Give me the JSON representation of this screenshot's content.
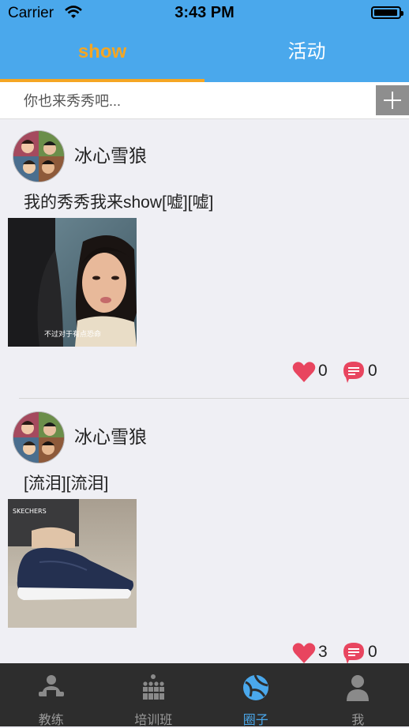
{
  "status_bar": {
    "carrier": "Carrier",
    "time": "3:43 PM",
    "battery_level": 0.95
  },
  "top_tabs": [
    {
      "label": "show",
      "active": true
    },
    {
      "label": "活动",
      "active": false
    }
  ],
  "search": {
    "placeholder": "你也来秀秀吧...",
    "value": ""
  },
  "posts": [
    {
      "username": "冰心雪狼",
      "content": "我的秀秀我来show[嘘][嘘]",
      "likes": "0",
      "comments": "0",
      "image": "woman-closeup-photo"
    },
    {
      "username": "冰心雪狼",
      "content": "[流泪][流泪]",
      "likes": "3",
      "comments": "0",
      "image": "navy-shoe-photo"
    }
  ],
  "tab_bar": [
    {
      "label": "教练",
      "icon": "coach-icon",
      "active": false
    },
    {
      "label": "培训班",
      "icon": "class-icon",
      "active": false
    },
    {
      "label": "圈子",
      "icon": "circle-ball-icon",
      "active": true
    },
    {
      "label": "我",
      "icon": "person-icon",
      "active": false
    }
  ],
  "colors": {
    "primary": "#4aa8ec",
    "accent": "#f5a623",
    "like": "#e8455f",
    "tabbar_bg": "#2d2d2d"
  }
}
